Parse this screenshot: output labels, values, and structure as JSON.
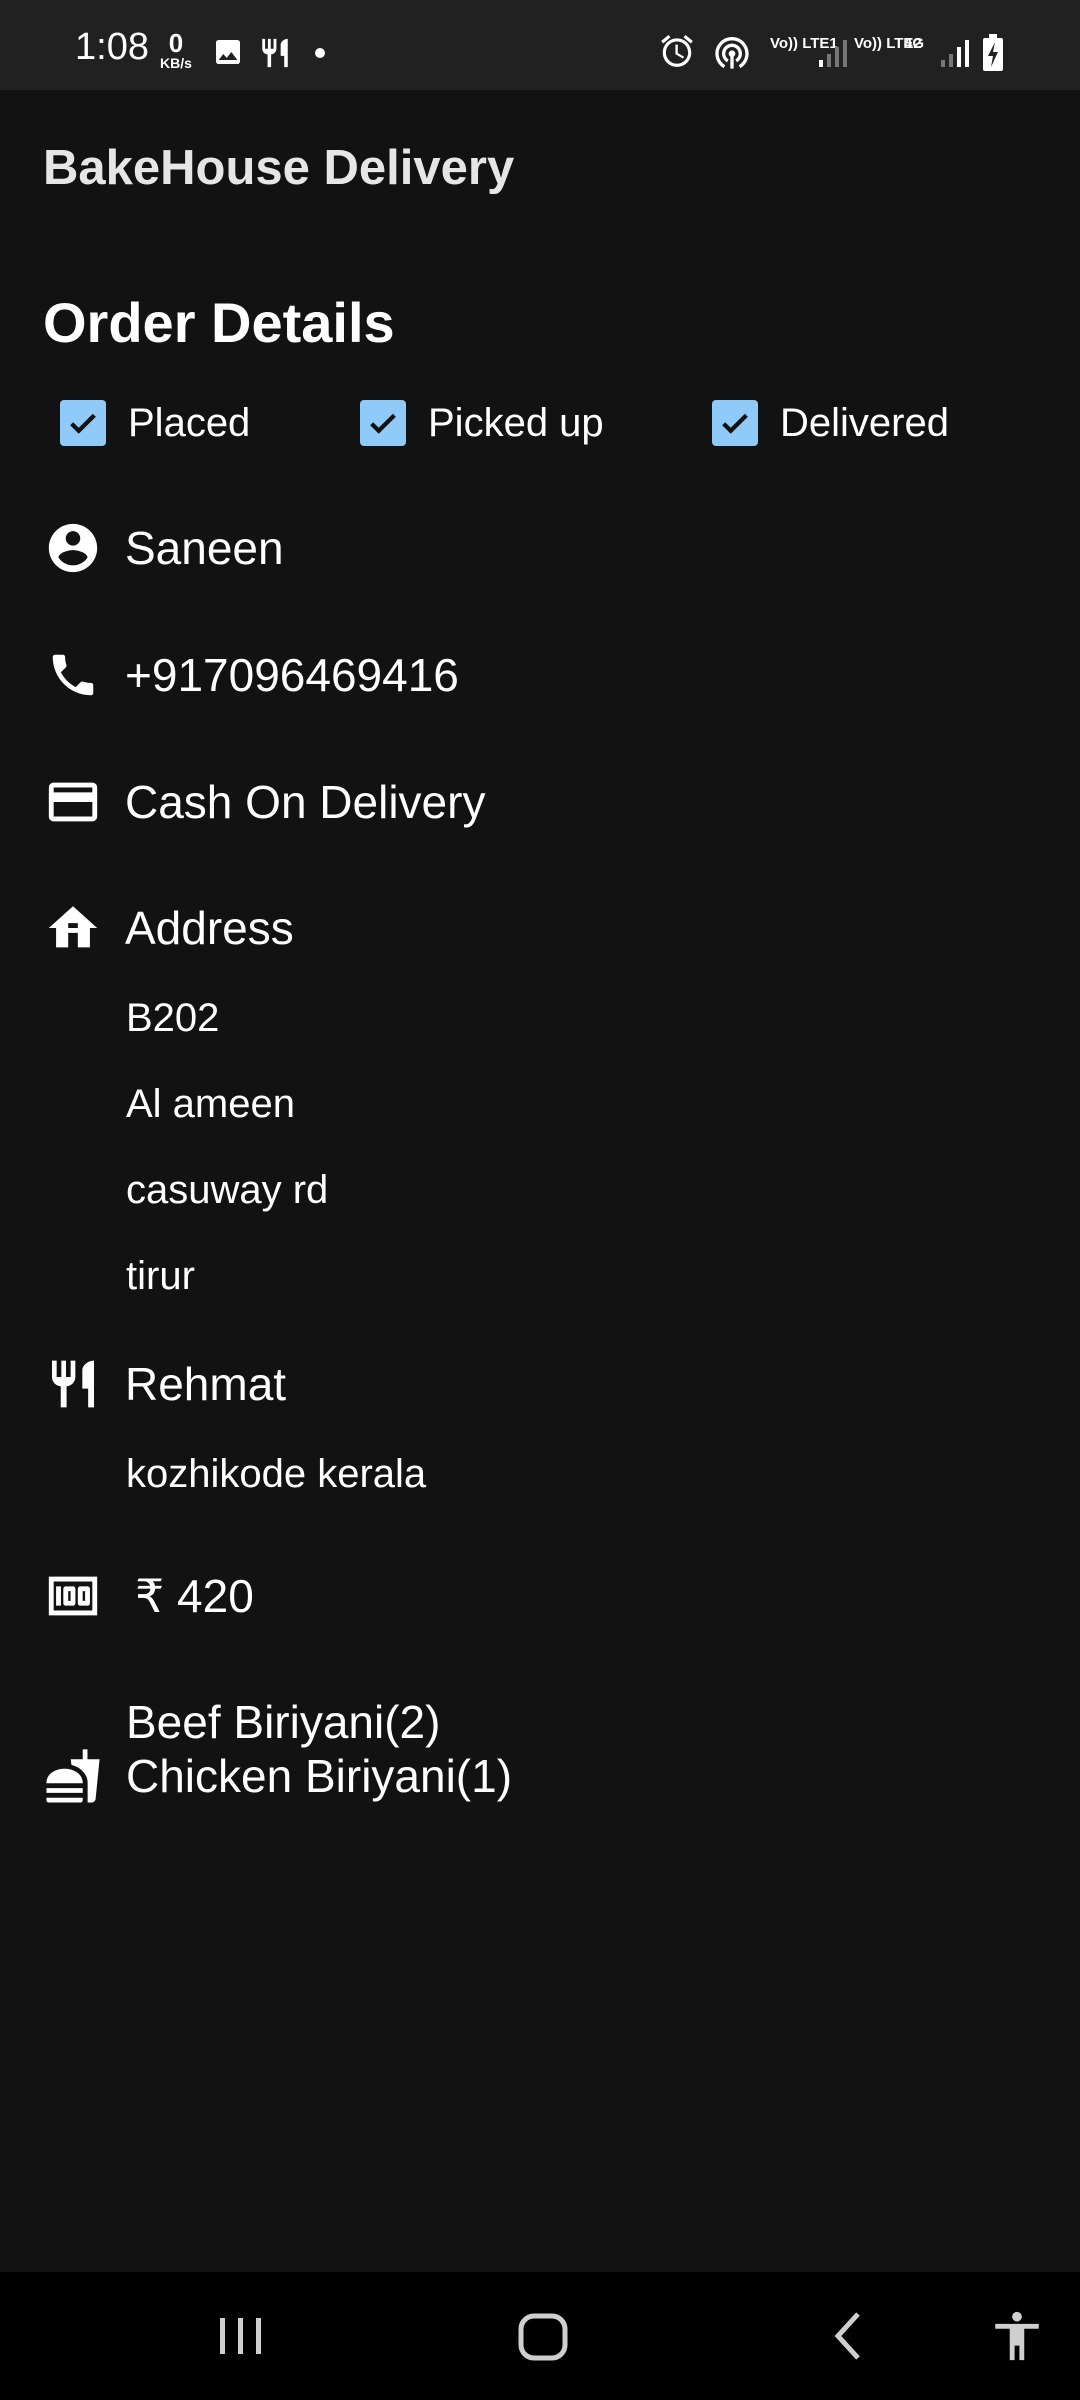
{
  "status_bar": {
    "time": "1:08",
    "speed_value": "0",
    "speed_unit": "KB/s",
    "sim1": "Vo)) LTE1",
    "sim2": "Vo)) LTE2",
    "network": "4G",
    "icons": [
      "image-icon",
      "fork-knife-icon",
      "dot-icon",
      "alarm-icon",
      "hotspot-icon",
      "signal-icon",
      "battery-charging-icon"
    ]
  },
  "app": {
    "title": "BakeHouse Delivery"
  },
  "order": {
    "title": "Order Details",
    "statuses": [
      {
        "label": "Placed",
        "checked": true
      },
      {
        "label": "Picked up",
        "checked": true
      },
      {
        "label": "Delivered",
        "checked": true
      }
    ],
    "customer_name": "Saneen",
    "phone": "+917096469416",
    "payment": "Cash On Delivery",
    "address_label": "Address",
    "address_lines": [
      "B202",
      "Al ameen",
      "casuway rd",
      "tirur"
    ],
    "restaurant_name": "Rehmat",
    "restaurant_location": "kozhikode kerala",
    "amount": "₹ 420",
    "items": [
      "Beef Biriyani(2)",
      "Chicken Biriyani(1)"
    ]
  },
  "colors": {
    "background": "#121212",
    "status_bar": "#212121",
    "checkbox": "#90caf9",
    "nav_bar": "#000000"
  }
}
